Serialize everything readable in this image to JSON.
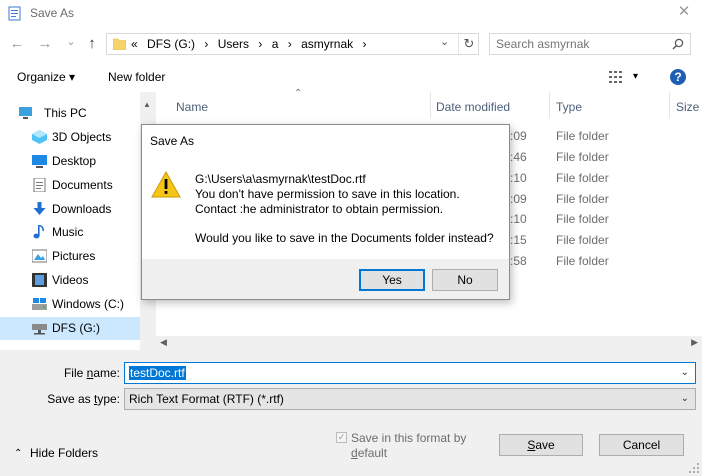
{
  "window": {
    "title": "Save As",
    "close_glyph": "✕"
  },
  "nav": {
    "back_glyph": "←",
    "forward_glyph": "→",
    "recent_glyph": "⌄",
    "up_glyph": "↑",
    "breadcrumb": [
      "«",
      "DFS (G:)",
      "›",
      "Users",
      "›",
      "a",
      "›",
      "asmyrnak",
      "›"
    ],
    "breadcrumb_dropdown": "⌄",
    "refresh_glyph": "↻",
    "search_placeholder": "Search asmyrnak"
  },
  "toolbar": {
    "organize": "Organize ▾",
    "new_folder": "New folder",
    "view_glyph": "▾",
    "help_glyph": "?"
  },
  "sidebar": {
    "items": [
      {
        "label": "This PC",
        "icon": "pc-icon"
      },
      {
        "label": "3D Objects",
        "icon": "cube-icon"
      },
      {
        "label": "Desktop",
        "icon": "desktop-icon"
      },
      {
        "label": "Documents",
        "icon": "documents-icon"
      },
      {
        "label": "Downloads",
        "icon": "download-icon"
      },
      {
        "label": "Music",
        "icon": "music-icon"
      },
      {
        "label": "Pictures",
        "icon": "pictures-icon"
      },
      {
        "label": "Videos",
        "icon": "videos-icon"
      },
      {
        "label": "Windows (C:)",
        "icon": "drive-icon"
      },
      {
        "label": "DFS (G:)",
        "icon": "network-drive-icon"
      }
    ]
  },
  "file_list": {
    "columns": [
      "Name",
      "Date modified",
      "Type",
      "Size"
    ],
    "rows": [
      {
        "date_fragment": ":09",
        "type": "File folder"
      },
      {
        "date_fragment": ":46",
        "type": "File folder"
      },
      {
        "date_fragment": ":10",
        "type": "File folder"
      },
      {
        "date_fragment": ":09",
        "type": "File folder"
      },
      {
        "date_fragment": ":10",
        "type": "File folder"
      },
      {
        "date_fragment": ":15",
        "type": "File folder"
      },
      {
        "date_fragment": ":58",
        "type": "File folder"
      }
    ]
  },
  "form": {
    "file_name_label_pre": "File ",
    "file_name_label_u": "n",
    "file_name_label_post": "ame:",
    "file_name_value": "testDoc.rtf",
    "save_type_label_pre": "Save as ",
    "save_type_label_u": "t",
    "save_type_label_post": "ype:",
    "save_type_value": "Rich Text Format (RTF) (*.rtf)",
    "dropdown_glyph": "⌄",
    "checkbox_label_line1": "Save in this format by",
    "checkbox_label_line2_u": "d",
    "checkbox_label_line2_post": "efault",
    "hide_folders": "Hide Folders",
    "save_button": "Save",
    "save_button_u": "S",
    "cancel_button": "Cancel"
  },
  "dialog": {
    "title": "Save As",
    "lines": [
      "G:\\Users\\a\\asmyrnak\\testDoc.rtf",
      "You don't have permission to save in this location.",
      "Contact :he administrator to obtain permission.",
      "Would you like to save in the Documents folder instead?"
    ],
    "yes_button": "Yes",
    "no_button": "No"
  },
  "colors": {
    "accent": "#0078d7",
    "selection": "#cce8ff",
    "warning": "#f5c518"
  }
}
